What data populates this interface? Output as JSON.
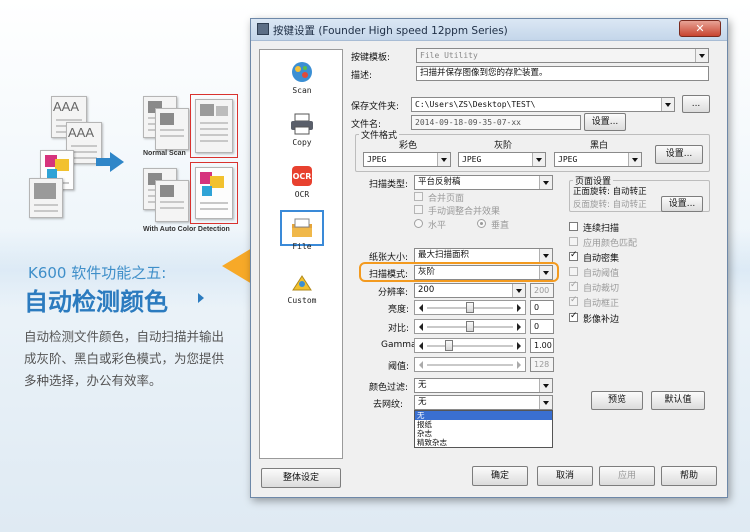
{
  "marketing": {
    "feature_number": "K600 软件功能之五:",
    "feature_title": "自动检测颜色",
    "description": "自动检测文件颜色，自动扫描并输出成灰阶、黑白或彩色模式，为您提供多种选择，办公有效率。",
    "illustration": {
      "doc_text_1": "AAA",
      "doc_text_2": "AAA",
      "label_normal": "Normal Scan",
      "label_auto": "With Auto Color Detection"
    },
    "accent": "#2b7bbf",
    "arrow_color": "#f7a928"
  },
  "dialog": {
    "title": "按键设置 (Founder High speed 12ppm Series)",
    "close_label": "✕",
    "nav": [
      {
        "label": "Scan",
        "icon": "scan-icon"
      },
      {
        "label": "Copy",
        "icon": "printer-icon"
      },
      {
        "label": "OCR",
        "icon": "ocr-icon"
      },
      {
        "label": "File",
        "icon": "file-icon",
        "selected": true
      },
      {
        "label": "Custom",
        "icon": "custom-icon"
      }
    ],
    "template_label": "按键模板:",
    "template_value": "File Utility",
    "desc_label": "描述:",
    "desc_value": "扫描并保存图像到您的存贮装置。",
    "save_folder_label": "保存文件夹:",
    "save_folder_value": "C:\\Users\\ZS\\Desktop\\TEST\\",
    "browse_label": "...",
    "filename_label": "文件名:",
    "filename_value": "2014-09-18-09-35-07-xx",
    "filename_settings": "设置...",
    "file_format": {
      "group_label": "文件格式",
      "color_label": "彩色",
      "gray_label": "灰阶",
      "bw_label": "黑白",
      "color_value": "JPEG",
      "gray_value": "JPEG",
      "bw_value": "JPEG",
      "settings_label": "设置..."
    },
    "scan_type_label": "扫描类型:",
    "scan_type_value": "平台反射稿",
    "merge_pages": "合并页面",
    "manual_merge": "手动调整合并效果",
    "horizontal": "水平",
    "vertical": "垂直",
    "page_settings": {
      "group_label": "页面设置",
      "front_rotate": "正面旋转: 自动转正",
      "back_rotate": "反面旋转: 自动转正",
      "settings_label": "设置..."
    },
    "continuous_scan": "连续扫描",
    "apply_color_match": "应用颜色匹配",
    "auto_density": "自动密集",
    "auto_threshold": "自动阈值",
    "auto_crop": "自动裁切",
    "auto_deskew": "自动框正",
    "image_fill": "影像补边",
    "paper_size_label": "纸张大小:",
    "paper_size_value": "最大扫描面积",
    "scan_mode_label": "扫描模式:",
    "scan_mode_value": "灰阶",
    "resolution_label": "分辨率:",
    "resolution_value": "200",
    "resolution_max": "200",
    "brightness_label": "亮度:",
    "brightness_value": "0",
    "brightness_level": 0.5,
    "contrast_label": "对比:",
    "contrast_value": "0",
    "contrast_level": 0.5,
    "gamma_label": "Gamma:",
    "gamma_value": "1.00",
    "gamma_level": 0.23,
    "threshold_label": "阈值:",
    "threshold_value": "128",
    "threshold_level": 0.5,
    "color_filter_label": "颜色过滤:",
    "color_filter_value": "无",
    "descreen_label": "去网纹:",
    "descreen_value": "无",
    "descreen_options": [
      "无",
      "报纸",
      "杂志",
      "精致杂志"
    ],
    "preview_label": "预览",
    "default_label": "默认值",
    "global_settings": "整体设定",
    "ok_label": "确定",
    "cancel_label": "取消",
    "apply_label": "应用",
    "help_label": "帮助"
  }
}
